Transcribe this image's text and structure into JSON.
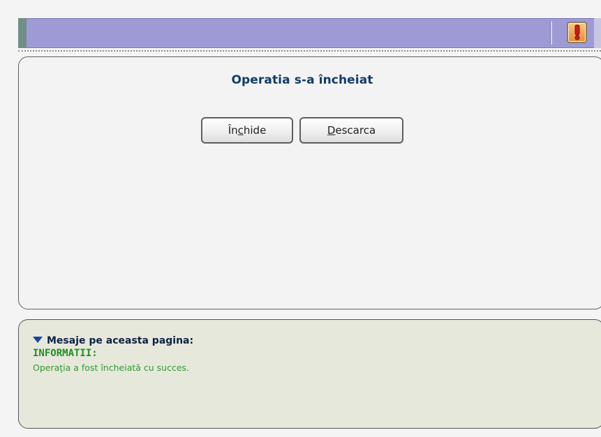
{
  "title_bar": {
    "alert_icon": "exclamation-alert-icon",
    "color": "#9d9ad6"
  },
  "dialog": {
    "title": "Operatia s-a încheiat",
    "buttons": {
      "close": {
        "before": "În",
        "accel": "c",
        "after": "hide"
      },
      "download": {
        "before": "",
        "accel": "D",
        "after": "escarca"
      }
    }
  },
  "messages": {
    "header": "Mesaje pe aceasta pagina:",
    "info_label": "INFORMATII:",
    "info_text": "Operaţia a fost încheiată cu succes.",
    "colors": {
      "header": "#0d2242",
      "info": "#2e9a2e"
    }
  }
}
